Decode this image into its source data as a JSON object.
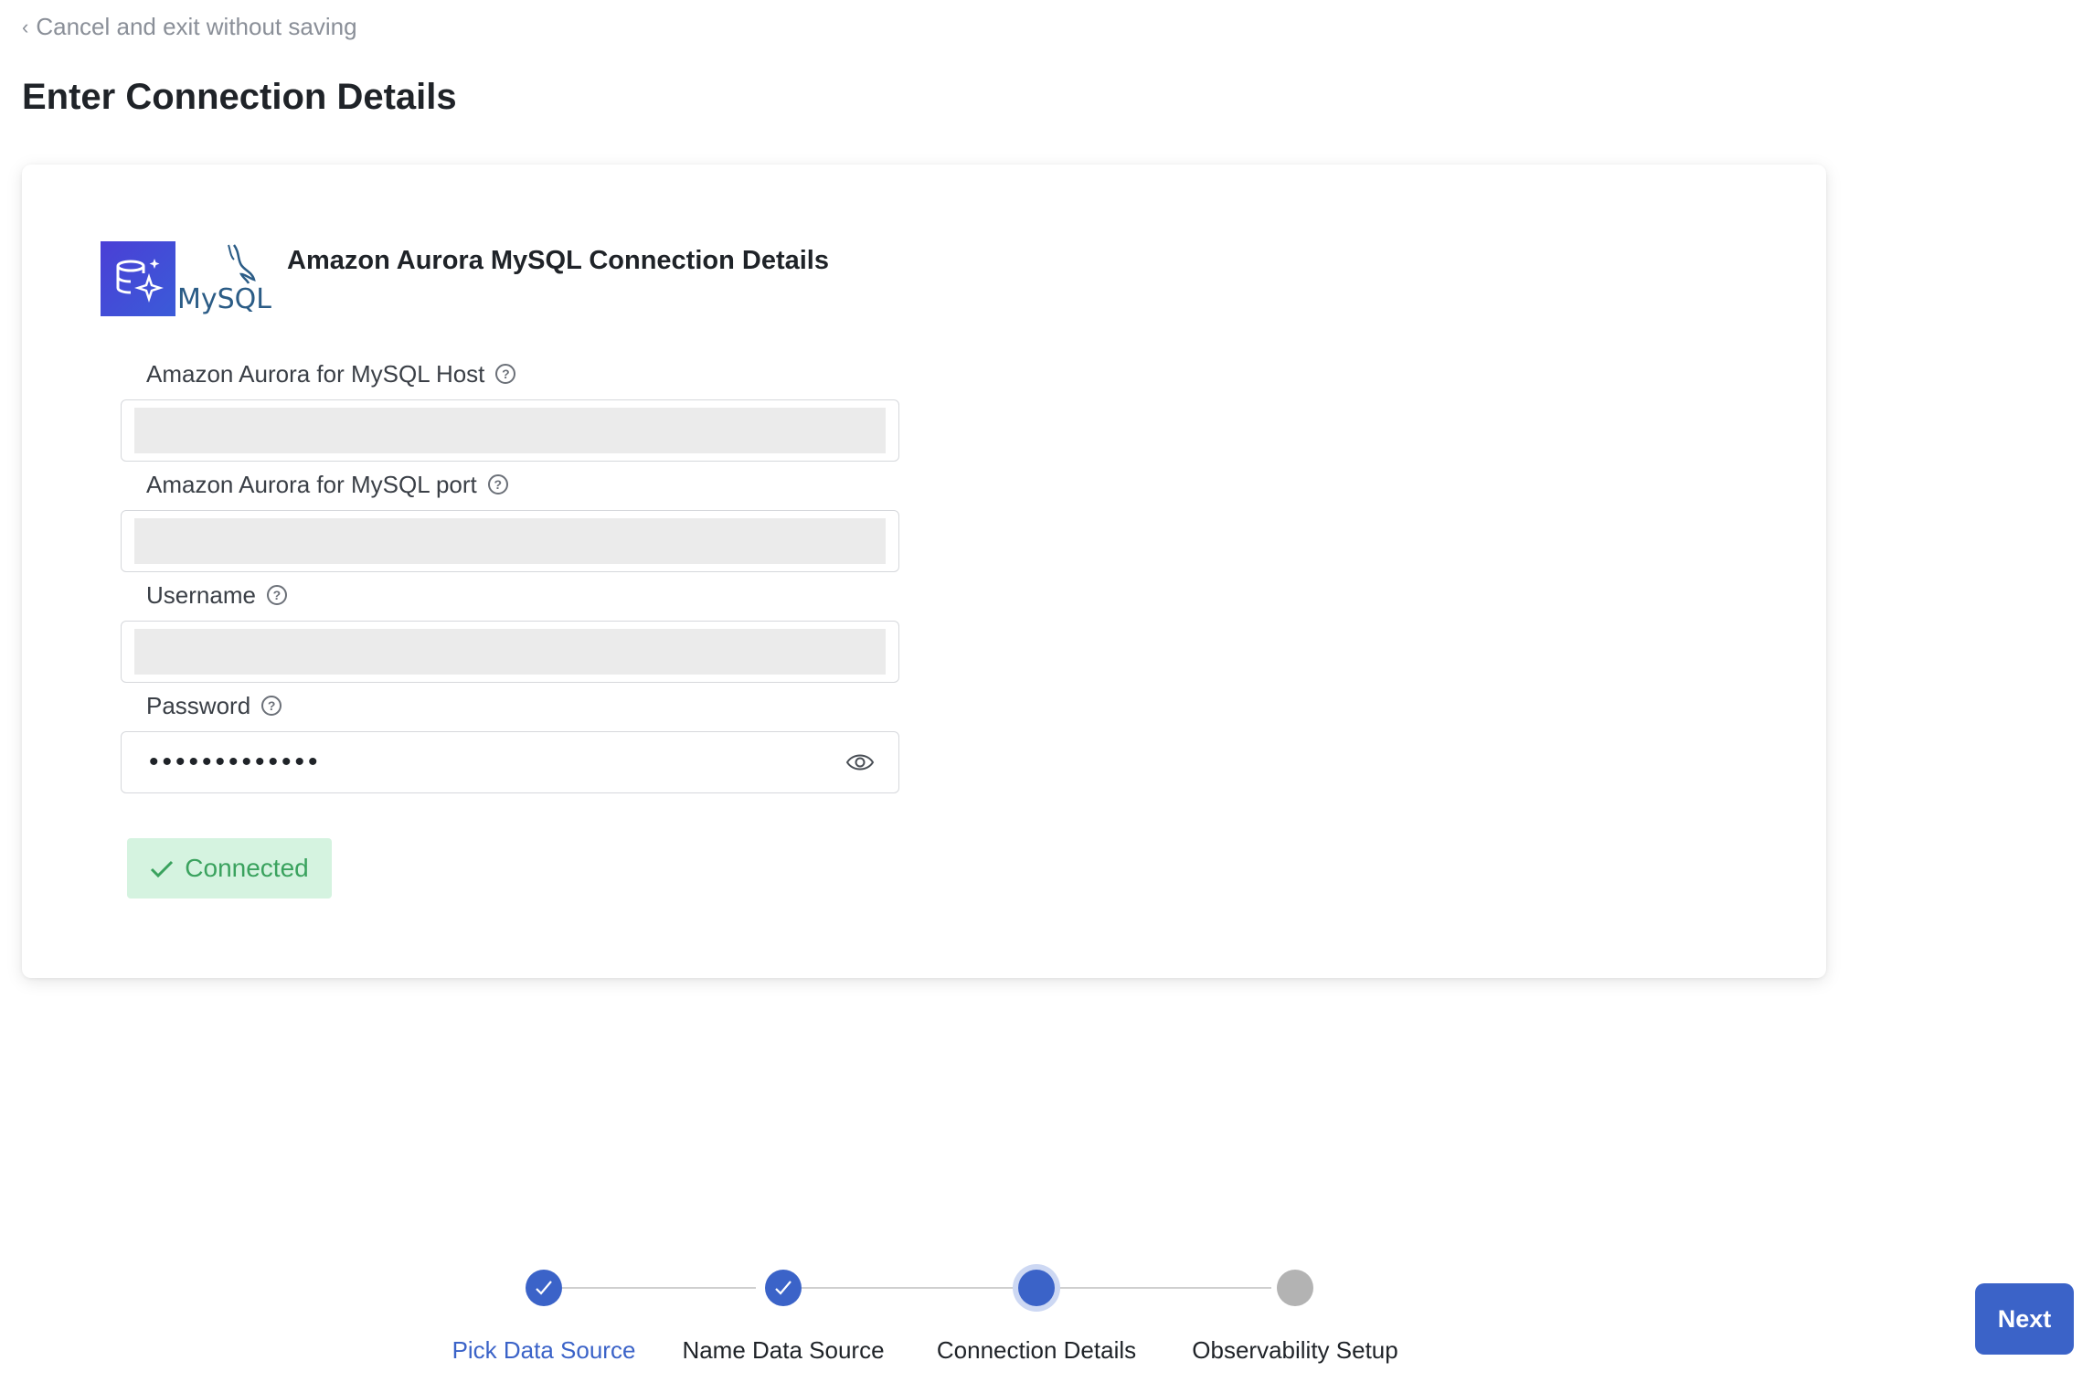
{
  "nav": {
    "back_label": "Cancel and exit without saving"
  },
  "page": {
    "title": "Enter Connection Details"
  },
  "card": {
    "title": "Amazon Aurora MySQL Connection Details",
    "logo_text": "MySQL",
    "fields": [
      {
        "label": "Amazon Aurora for MySQL Host",
        "value": ""
      },
      {
        "label": "Amazon Aurora for MySQL port",
        "value": ""
      },
      {
        "label": "Username",
        "value": ""
      },
      {
        "label": "Password",
        "value": "•••••••••••••"
      }
    ],
    "status": "Connected"
  },
  "stepper": {
    "steps": [
      {
        "label": "Pick Data Source",
        "state": "done"
      },
      {
        "label": "Name Data Source",
        "state": "done"
      },
      {
        "label": "Connection Details",
        "state": "current"
      },
      {
        "label": "Observability Setup",
        "state": "todo"
      }
    ]
  },
  "actions": {
    "next_label": "Next"
  },
  "colors": {
    "accent": "#3b63c8",
    "success_bg": "#d5f3e0",
    "success_text": "#3aa25e"
  },
  "icons": {
    "back": "chevron-left-icon",
    "help": "question-circle-icon",
    "reveal": "eye-icon",
    "status": "check-icon",
    "step_done": "check-icon"
  }
}
